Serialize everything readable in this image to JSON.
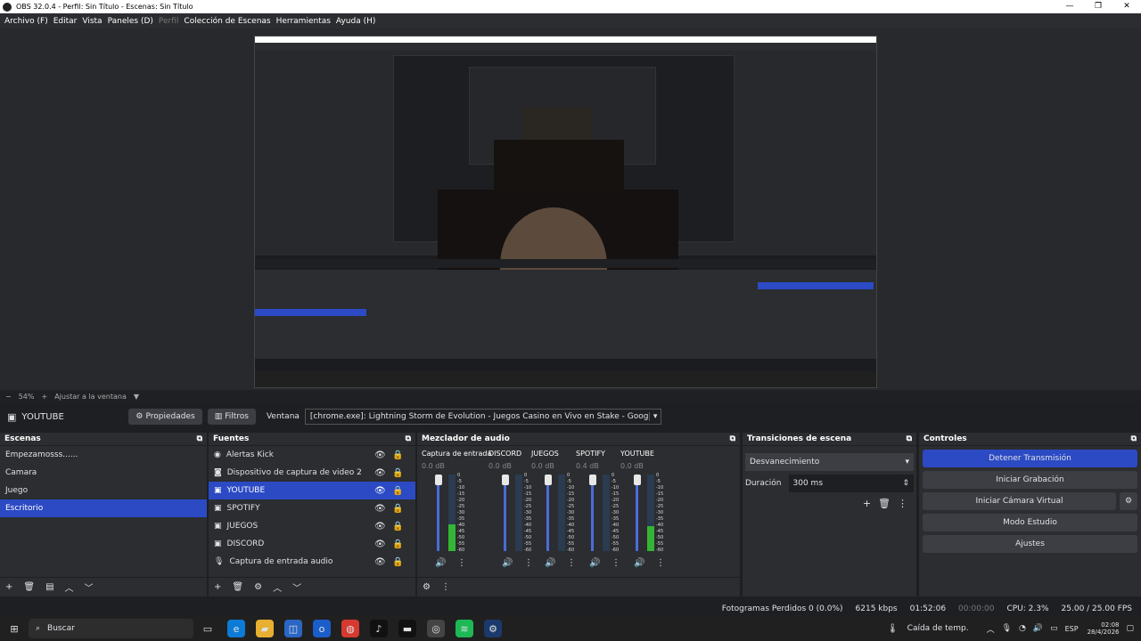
{
  "window": {
    "title": "OBS 32.0.4 - Perfil: Sin Título - Escenas: Sin Título"
  },
  "menu": [
    "Archivo (F)",
    "Editar",
    "Vista",
    "Paneles (D)",
    "Perfil",
    "Colección de Escenas",
    "Herramientas",
    "Ayuda (H)"
  ],
  "zoom": {
    "level": "54%",
    "fit": "Ajustar a la ventana"
  },
  "source_bar": {
    "name": "YOUTUBE",
    "properties": "Propiedades",
    "filters": "Filtros",
    "window_label": "Ventana",
    "window_value": "[chrome.exe]: Lightning Storm de Evolution - Juegos Casino en Vivo en Stake - Google Chrome"
  },
  "scenes": {
    "title": "Escenas",
    "items": [
      "Empezamosss......",
      "Camara",
      "Juego",
      "Escritorio"
    ],
    "selected": 3
  },
  "sources": {
    "title": "Fuentes",
    "items": [
      "Alertas Kick",
      "Dispositivo de captura de video 2",
      "YOUTUBE",
      "SPOTIFY",
      "JUEGOS",
      "DISCORD",
      "Captura de entrada audio"
    ],
    "selected": 2
  },
  "mixer": {
    "title": "Mezclador de audio",
    "channels": [
      {
        "name": "Captura de entrada",
        "db": "0.0 dB",
        "level": 0.35
      },
      {
        "name": "DISCORD",
        "db": "0.0 dB",
        "level": 0.0
      },
      {
        "name": "JUEGOS",
        "db": "0.0 dB",
        "level": 0.0
      },
      {
        "name": "SPOTIFY",
        "db": "0.4 dB",
        "level": 0.0
      },
      {
        "name": "YOUTUBE",
        "db": "0.0 dB",
        "level": 0.32
      }
    ],
    "scale": [
      "0",
      "-5",
      "-10",
      "-15",
      "-20",
      "-25",
      "-30",
      "-35",
      "-40",
      "-45",
      "-50",
      "-55",
      "-60"
    ]
  },
  "transitions": {
    "title": "Transiciones de escena",
    "type": "Desvanecimiento",
    "duration_label": "Duración",
    "duration": "300 ms"
  },
  "controls": {
    "title": "Controles",
    "buttons": [
      "Detener Transmisión",
      "Iniciar Grabación",
      "Iniciar Cámara Virtual",
      "Modo Estudio",
      "Ajustes"
    ]
  },
  "status": {
    "dropped": "Fotogramas Perdidos 0 (0.0%)",
    "bitrate": "6215 kbps",
    "stream_time": "01:52:06",
    "rec_time": "00:00:00",
    "cpu": "CPU: 2.3%",
    "fps": "25.00 / 25.00 FPS"
  },
  "taskbar": {
    "search": "Buscar",
    "weather": "Caída de temp.",
    "lang": "ESP",
    "time": "02:08",
    "date": "28/4/2026"
  },
  "colors": {
    "accent": "#2b4ac4",
    "panel": "#2b2d30",
    "bg": "#1e1f22"
  }
}
